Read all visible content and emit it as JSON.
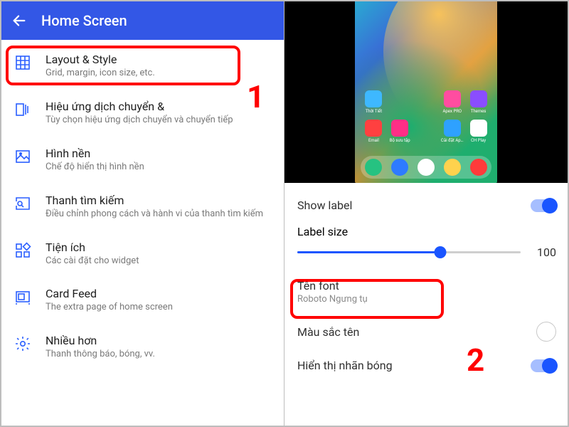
{
  "left": {
    "title": "Home Screen",
    "items": [
      {
        "title": "Layout & Style",
        "subtitle": "Grid, margin, icon size, etc."
      },
      {
        "title": "Hiệu ứng dịch chuyển &",
        "subtitle": "Tùy chọn hiệu ứng dịch chuyển và chuyển tiếp"
      },
      {
        "title": "Hình nền",
        "subtitle": "Chế độ hiển thị hình nền"
      },
      {
        "title": "Thanh tìm kiếm",
        "subtitle": "Điều chỉnh phong cách và hành vi của thanh tìm kiếm"
      },
      {
        "title": "Tiện ích",
        "subtitle": "Các cài đặt cho widget"
      },
      {
        "title": "Card Feed",
        "subtitle": "The extra page of home screen"
      },
      {
        "title": "Nhiều hơn",
        "subtitle": "Thanh thông báo, bóng, vv."
      }
    ],
    "highlight_badge": "1"
  },
  "right": {
    "preview_apps_row1": [
      {
        "label": "Thời Tiết",
        "color": "#3eb8ff"
      },
      {
        "label": "",
        "color": "transparent"
      },
      {
        "label": "",
        "color": "transparent"
      },
      {
        "label": "Apex PRO",
        "color": "#ff4da0"
      },
      {
        "label": "Themes",
        "color": "#8a4dff"
      }
    ],
    "preview_apps_row2": [
      {
        "label": "Email",
        "color": "#ff4040"
      },
      {
        "label": "Bộ sưu tập",
        "color": "#ff2e86"
      },
      {
        "label": "",
        "color": "transparent"
      },
      {
        "label": "Cài đặt Ap…",
        "color": "#2ea1ff"
      },
      {
        "label": "CH Play",
        "color": "#ffffff"
      }
    ],
    "dock": [
      "#26c281",
      "#2e7bff",
      "#ffffff",
      "#ffd24d",
      "#ff3b3b"
    ],
    "show_label": {
      "label": "Show label",
      "value": true
    },
    "label_size": {
      "label": "Label size",
      "value": 100,
      "percent": 64
    },
    "font": {
      "label": "Tên font",
      "value": "Roboto Ngưng tụ"
    },
    "name_color": {
      "label": "Màu sắc tên"
    },
    "shadow": {
      "label": "Hiển thị nhãn bóng",
      "value": true
    },
    "highlight_badge": "2"
  }
}
